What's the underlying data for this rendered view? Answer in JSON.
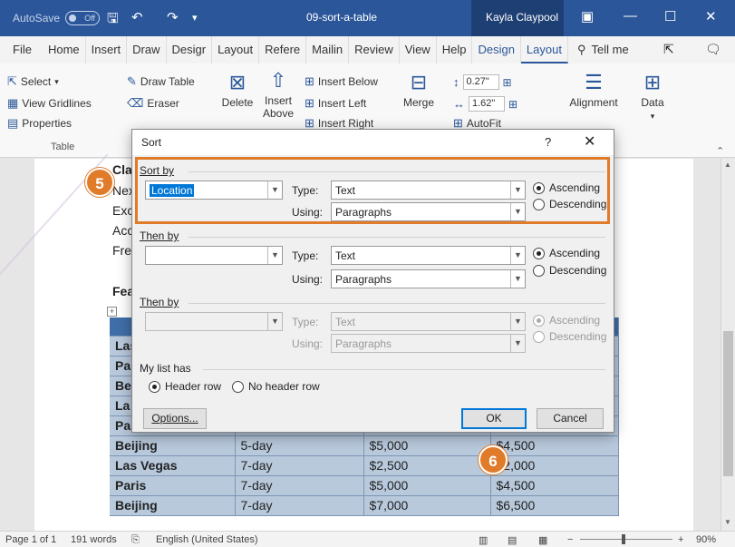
{
  "titlebar": {
    "autosave_label": "AutoSave",
    "autosave_state": "Off",
    "save_icon": "save-icon",
    "undo_icon": "undo-icon",
    "redo_icon": "redo-icon",
    "quick_access_icon": "chevron-down-icon",
    "doc_title": "09-sort-a-table",
    "user": "Kayla Claypool",
    "ribbon_display_icon": "ribbon-display-icon",
    "minimize_icon": "minimize-icon",
    "maximize_icon": "maximize-icon",
    "close_icon": "close-icon"
  },
  "tabs": {
    "items": [
      "File",
      "Home",
      "Insert",
      "Draw",
      "Desigr",
      "Layout",
      "Refere",
      "Mailin",
      "Review",
      "View",
      "Help"
    ],
    "design": "Design",
    "layout_active": "Layout",
    "tell_me": "Tell me",
    "share_icon": "share-icon",
    "comment_icon": "comment-icon"
  },
  "ribbon": {
    "select": "Select",
    "view_gridlines": "View Gridlines",
    "properties": "Properties",
    "table_group": "Table",
    "draw_table": "Draw Table",
    "eraser": "Eraser",
    "delete": "Delete",
    "insert_above_1": "Insert",
    "insert_above_2": "Above",
    "insert_below": "Insert Below",
    "insert_left": "Insert Left",
    "insert_right": "Insert Right",
    "merge": "Merge",
    "height": "0.27\"",
    "width": "1.62\"",
    "autofit": "AutoFit",
    "alignment": "Alignment",
    "data": "Data"
  },
  "document": {
    "lines": [
      "Clas",
      "Nex",
      "Exc",
      "Acc",
      "Free"
    ],
    "heading2": "Fea",
    "table_partial_rows": [
      "Las",
      "Pa",
      "Be",
      "La",
      "Pa"
    ],
    "table_rows": [
      [
        "Beijing",
        "5-day",
        "$5,000",
        "$4,500"
      ],
      [
        "Las Vegas",
        "7-day",
        "$2,500",
        "$2,000"
      ],
      [
        "Paris",
        "7-day",
        "$5,000",
        "$4,500"
      ],
      [
        "Beijing",
        "7-day",
        "$7,000",
        "$6,500"
      ]
    ]
  },
  "dialog": {
    "title": "Sort",
    "help": "?",
    "close": "✕",
    "sort_by": "Sort by",
    "sort_by_value": "Location",
    "then_by_1": "Then by",
    "then_by_2": "Then by",
    "type_label": "Type:",
    "using_label": "Using:",
    "type_value": "Text",
    "using_value": "Paragraphs",
    "ascending": "Ascending",
    "descending": "Descending",
    "my_list_has": "My list has",
    "header_row": "Header row",
    "no_header_row": "No header row",
    "options": "Options...",
    "ok": "OK",
    "cancel": "Cancel"
  },
  "callouts": {
    "step5": "5",
    "step6": "6"
  },
  "statusbar": {
    "page": "Page 1 of 1",
    "words": "191 words",
    "language": "English (United States)",
    "zoom": "90%",
    "zoom_minus": "−",
    "zoom_plus": "+"
  },
  "colors": {
    "word_blue": "#2b579a",
    "callout_orange": "#e07b2a",
    "table_band": "#b8c9dc"
  }
}
